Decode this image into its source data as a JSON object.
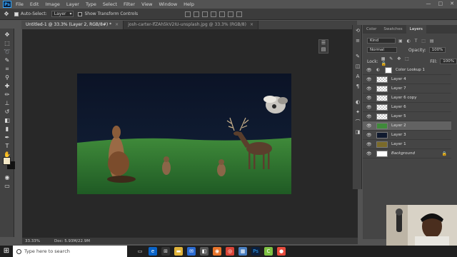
{
  "app": {
    "logo": "Ps"
  },
  "menu": [
    "File",
    "Edit",
    "Image",
    "Layer",
    "Type",
    "Select",
    "Filter",
    "View",
    "Window",
    "Help"
  ],
  "window_controls": {
    "minimize": "—",
    "maximize": "□",
    "close": "✕"
  },
  "options_bar": {
    "auto_select_label": "Auto-Select:",
    "auto_select_value": "Layer",
    "show_transform_label": "Show Transform Controls"
  },
  "tabs": [
    {
      "label": "Untitled-1 @ 33.3% (Layer 2, RGB/8#) *",
      "close": "×"
    },
    {
      "label": "josh-carter-lfZAh5kV2IU-unsplash.jpg @ 33.3% (RGB/8)",
      "close": "×"
    }
  ],
  "status": {
    "zoom": "33.33%",
    "doc": "Doc: 5.93M/22.9M"
  },
  "panel": {
    "tabs": [
      "Color",
      "Swatches",
      "Layers"
    ],
    "kind_label": "Kind",
    "blend_mode": "Normal",
    "opacity_label": "Opacity:",
    "opacity_value": "100%",
    "lock_label": "Lock:",
    "fill_label": "Fill:",
    "fill_value": "100%",
    "adjustment_layer": "Color Lookup 1",
    "layers": [
      {
        "name": "Layer 4",
        "selected": false
      },
      {
        "name": "Layer 7",
        "selected": false
      },
      {
        "name": "Layer 6 copy",
        "selected": false
      },
      {
        "name": "Layer 6",
        "selected": false
      },
      {
        "name": "Layer 5",
        "selected": false
      },
      {
        "name": "Layer 2",
        "selected": true
      },
      {
        "name": "Layer 3",
        "selected": false
      },
      {
        "name": "Layer 1",
        "selected": false
      },
      {
        "name": "Background",
        "selected": false
      }
    ]
  },
  "taskbar": {
    "search_placeholder": "Type here to search"
  },
  "colors": {
    "foreground": "#f3e7c6",
    "background": "#111111",
    "ps_blue": "#31a8ff"
  }
}
